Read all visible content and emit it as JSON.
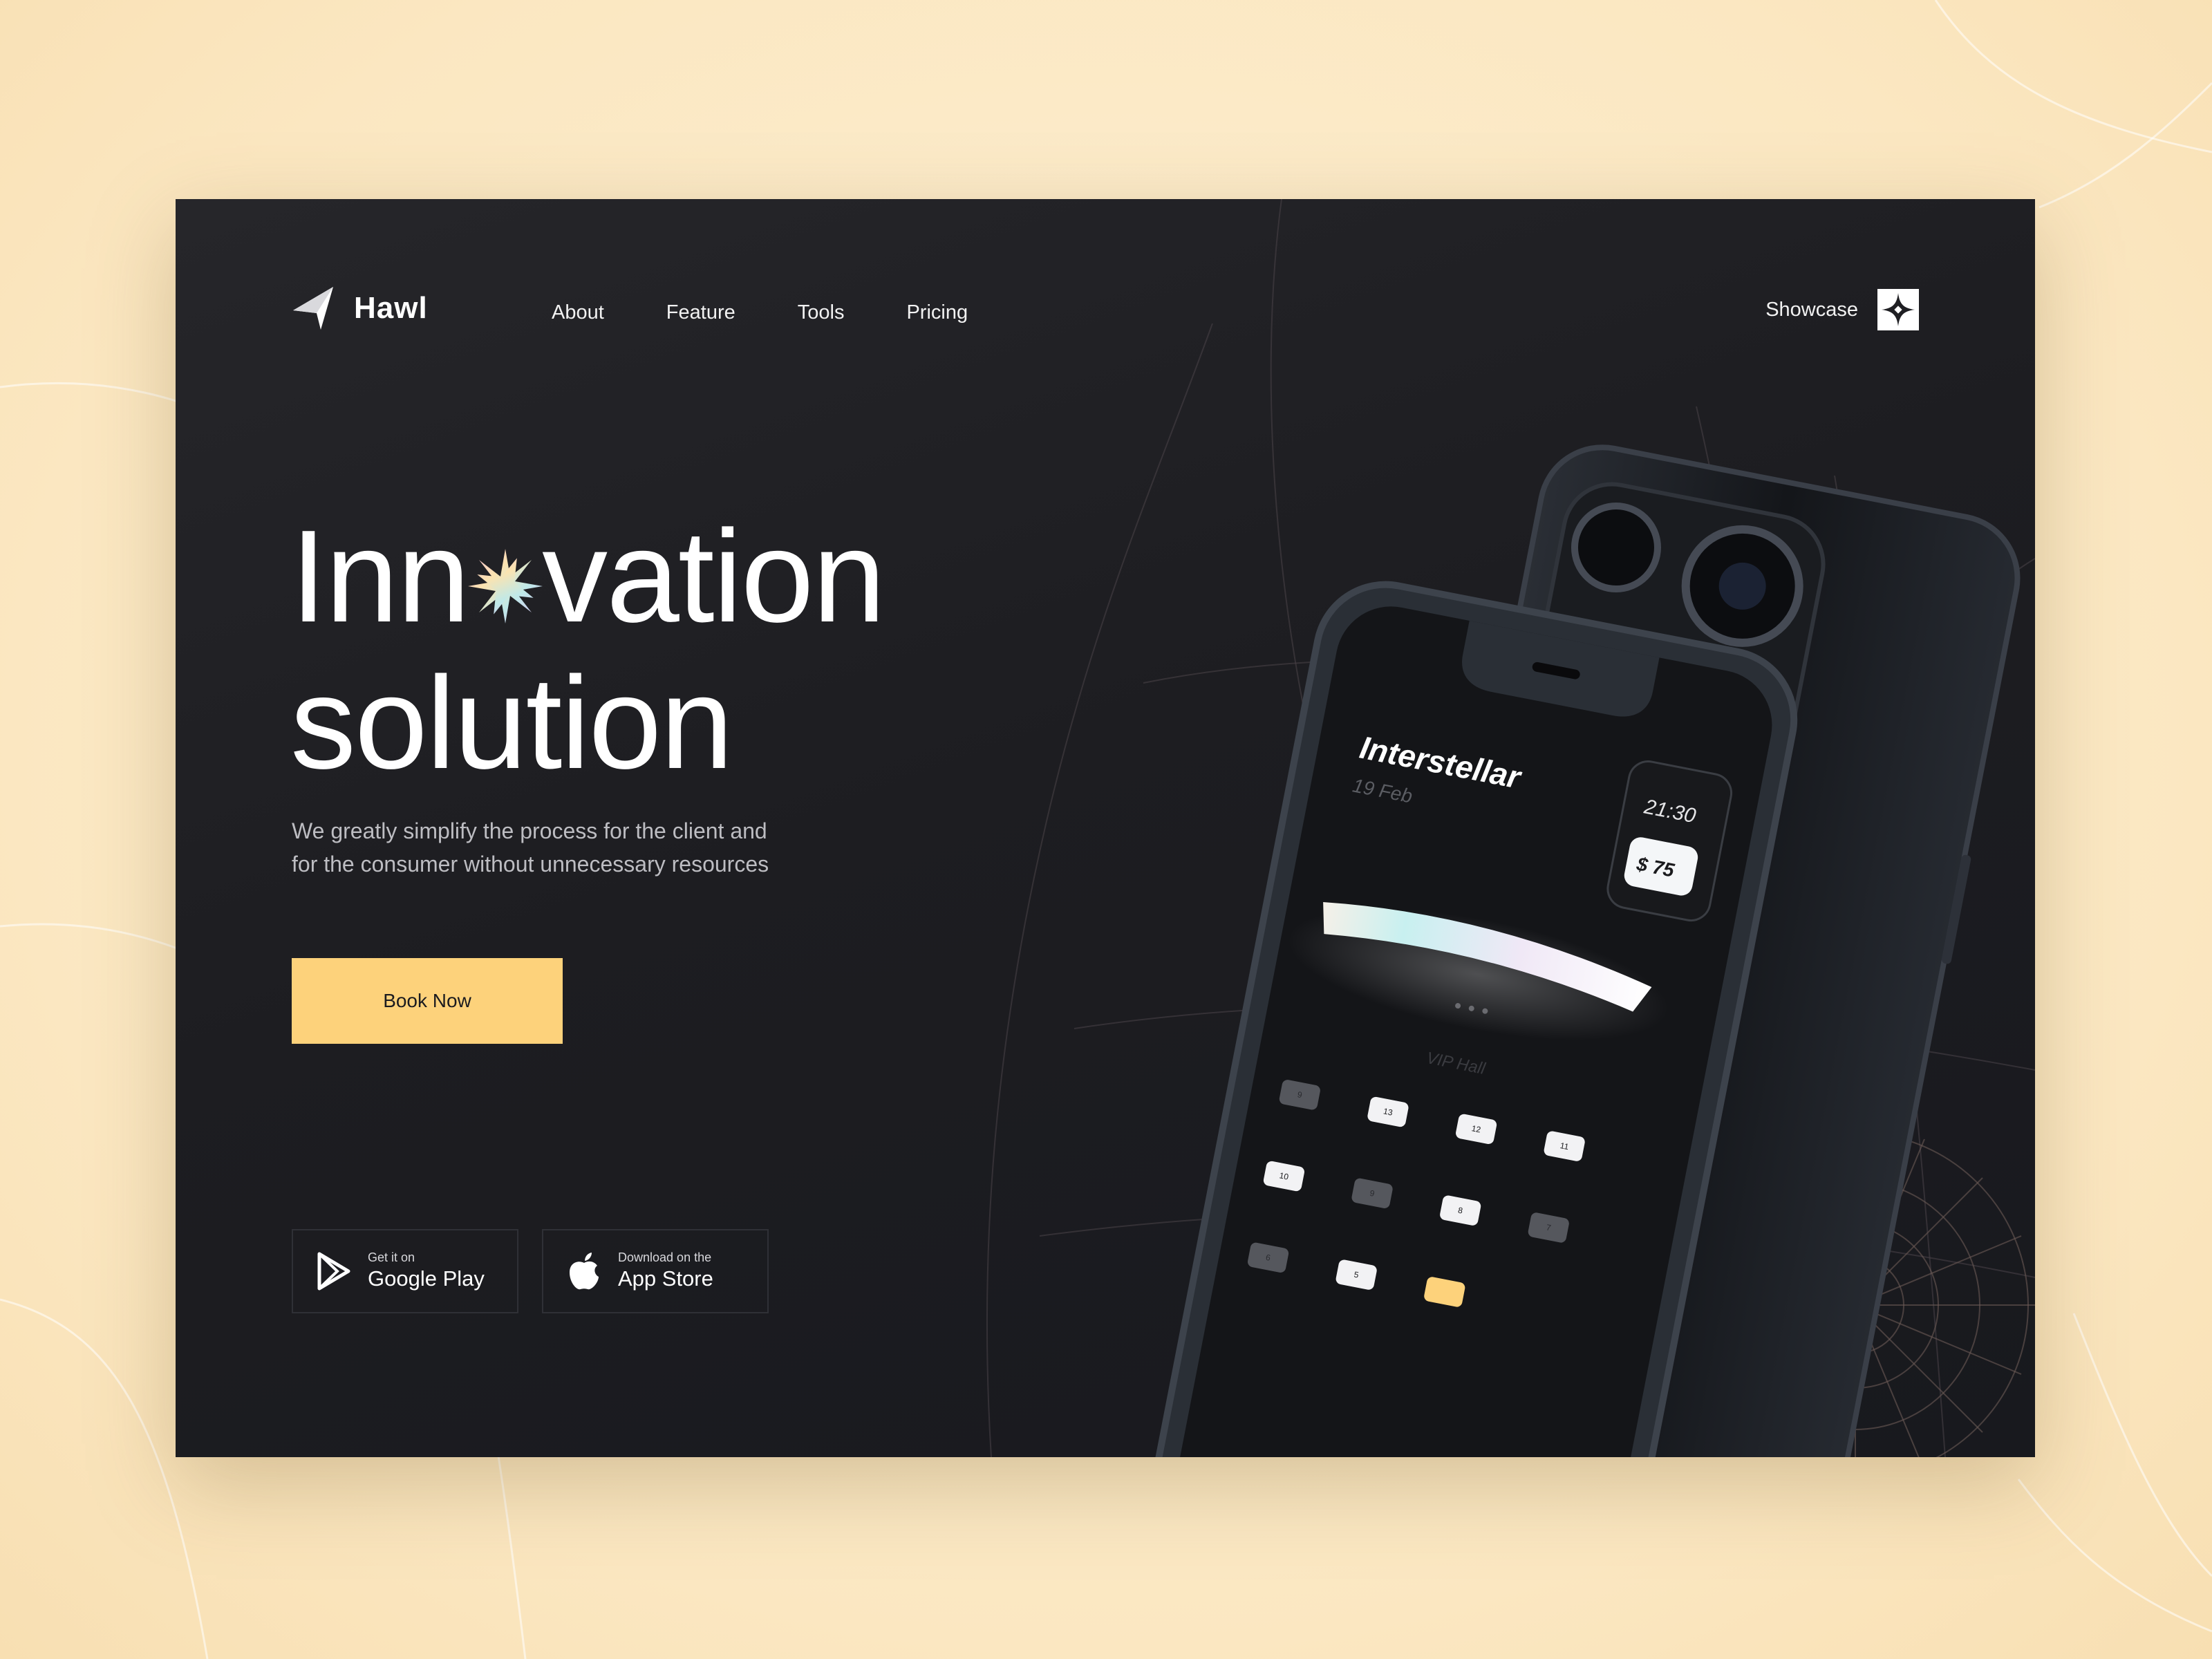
{
  "brand": {
    "name": "Hawl"
  },
  "nav": {
    "items": [
      {
        "label": "About"
      },
      {
        "label": "Feature"
      },
      {
        "label": "Tools"
      },
      {
        "label": "Pricing"
      }
    ],
    "showcase_label": "Showcase"
  },
  "hero": {
    "headline_line1_start": "Inn",
    "headline_line1_end": "vation",
    "headline_line2": "solution",
    "subtitle_line1": "We greatly simplify the process for the client and",
    "subtitle_line2": "for the consumer without unnecessary resources",
    "cta_label": "Book Now"
  },
  "stores": {
    "google": {
      "small": "Get it on",
      "big": "Google Play"
    },
    "apple": {
      "small": "Download on the",
      "big": "App Store"
    }
  },
  "phone_screen": {
    "movie_title": "Interstellar",
    "date": "19 Feb",
    "time": "21:30",
    "price": "$ 75",
    "hall": "VIP Hall",
    "seats": [
      "9",
      "13",
      "12",
      "11",
      "10",
      "9",
      "8",
      "7",
      "6",
      "5"
    ]
  },
  "colors": {
    "background": "#fbe9c4",
    "panel": "#1f1f23",
    "accent": "#fdd27b",
    "text": "#ffffff",
    "muted": "#bdbdc2"
  },
  "icons": {
    "logo": "paper-plane-icon",
    "showcase": "four-point-star-icon",
    "headline_o": "starburst-icon",
    "google_play": "play-triangle-icon",
    "app_store": "apple-icon"
  }
}
